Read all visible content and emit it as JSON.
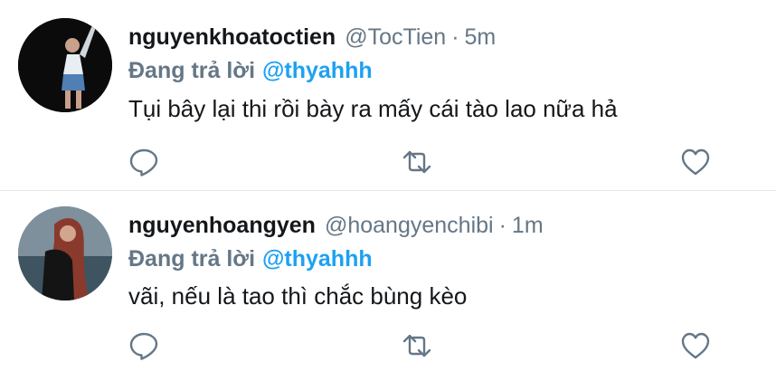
{
  "tweets": [
    {
      "display_name": "nguyenkhoatoctien",
      "handle": "@TocTien",
      "separator": "·",
      "time": "5m",
      "reply_label": "Đang trả lời",
      "reply_to": "@thyahhh",
      "text": "Tụi bây lại thi rồi bày ra mấy cái tào lao nữa hả"
    },
    {
      "display_name": "nguyenhoangyen",
      "handle": "@hoangyenchibi",
      "separator": "·",
      "time": "1m",
      "reply_label": "Đang trả lời",
      "reply_to": "@thyahhh",
      "text": "vãi, nếu là tao thì chắc bùng kèo"
    }
  ],
  "icons": {
    "reply": "reply-icon",
    "retweet": "retweet-icon",
    "like": "like-icon"
  },
  "colors": {
    "link": "#1da1f2",
    "secondary_text": "#657786",
    "icon": "#657786",
    "divider": "#e1e8ed"
  }
}
